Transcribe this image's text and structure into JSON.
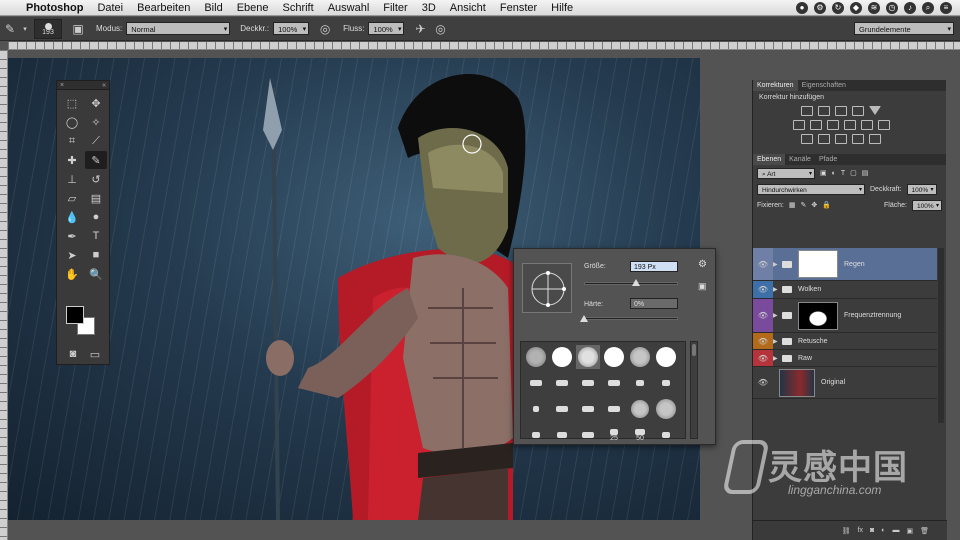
{
  "menubar": {
    "app": "Photoshop",
    "items": [
      "Datei",
      "Bearbeiten",
      "Bild",
      "Ebene",
      "Schrift",
      "Auswahl",
      "Filter",
      "3D",
      "Ansicht",
      "Fenster",
      "Hilfe"
    ]
  },
  "options": {
    "brush_size": "193",
    "mode_label": "Modus:",
    "mode_value": "Normal",
    "opacity_label": "Deckkr.:",
    "opacity_value": "100%",
    "flow_label": "Fluss:",
    "flow_value": "100%",
    "workspace": "Grundelemente"
  },
  "brush_picker": {
    "size_label": "Größe:",
    "size_value": "193 Px",
    "hardness_label": "Härte:",
    "hardness_value": "0%",
    "size_fraction": 0.55,
    "hardness_fraction": 0.0,
    "tip_labels": [
      "25",
      "50"
    ]
  },
  "adjustments": {
    "tab_active": "Korrekturen",
    "tab_inactive": "Eigenschaften",
    "title": "Korrektur hinzufügen"
  },
  "layers_panel": {
    "tabs": [
      "Ebenen",
      "Kanäle",
      "Pfade"
    ],
    "filter_label": "Art",
    "blend_mode": "Hindurchwirken",
    "opacity_label": "Deckkraft:",
    "opacity_value": "100%",
    "lock_label": "Fixieren:",
    "fill_label": "Fläche:",
    "fill_value": "100%",
    "layers": [
      {
        "name": "Regen",
        "color": "#6f7fa6",
        "selected": true
      },
      {
        "name": "Wolken",
        "color": "#3d6fa8",
        "selected": false
      },
      {
        "name": "Frequenztrennung",
        "color": "#7a4a9c",
        "selected": false
      },
      {
        "name": "Retusche",
        "color": "#b36a1a",
        "selected": false
      },
      {
        "name": "Raw",
        "color": "#b5333a",
        "selected": false
      },
      {
        "name": "Original",
        "color": "",
        "selected": false
      }
    ]
  },
  "watermark": {
    "chinese": "灵感中国",
    "domain": "lingganchina.com"
  }
}
